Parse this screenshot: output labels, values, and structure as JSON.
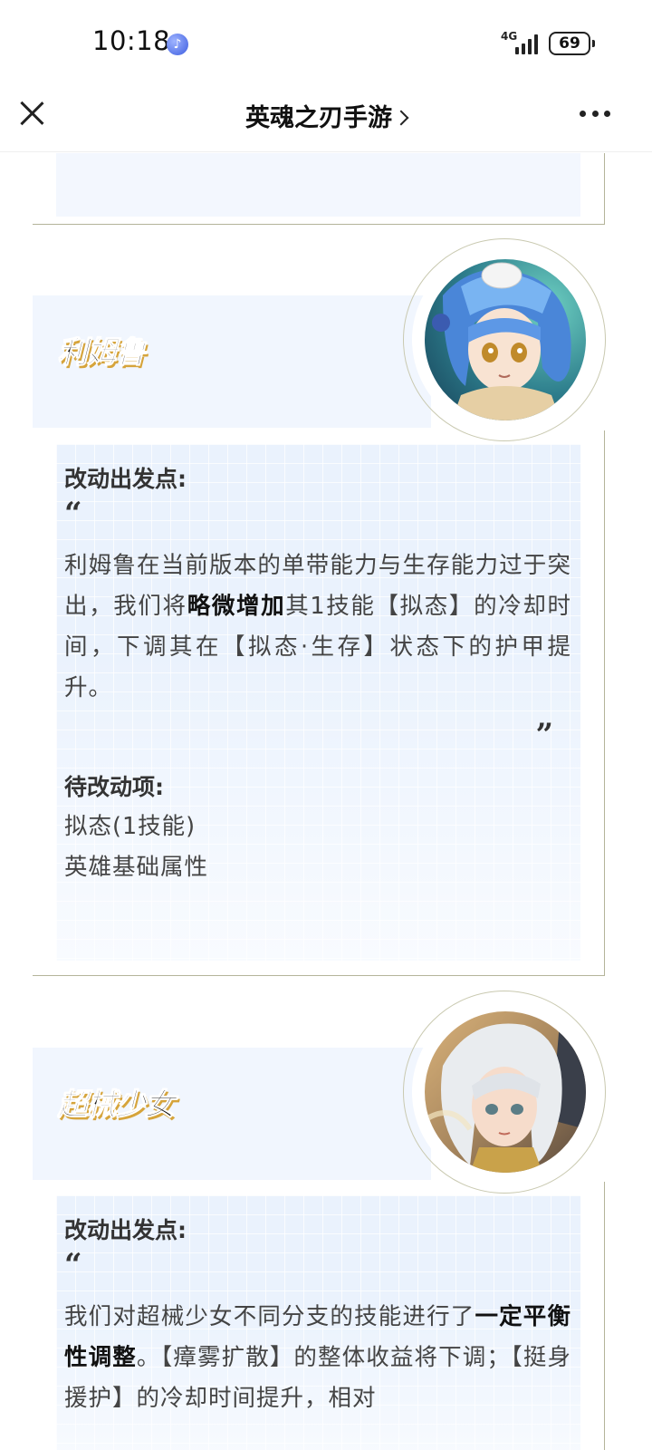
{
  "status": {
    "time": "10:18",
    "network": "4G",
    "battery": "69"
  },
  "nav": {
    "title": "英魂之刃手游"
  },
  "heroes": [
    {
      "name": "利姆鲁",
      "section_label": "改动出发点:",
      "quote_open": "“",
      "quote_close": "”",
      "text_1": "利姆鲁在当前版本的单带能力与生存能力过于突出，我们将",
      "text_bold": "略微增加",
      "text_2": "其1技能【拟态】的冷却时间，下调其在【拟态·生存】状态下的护甲提升。",
      "pending_label": "待改动项:",
      "pending_items": [
        "拟态(1技能)",
        "英雄基础属性"
      ]
    },
    {
      "name": "超械少女",
      "section_label": "改动出发点:",
      "quote_open": "“",
      "text_1": "我们对超械少女不同分支的技能进行了",
      "text_bold": "一定平衡性调整",
      "text_2": "。【瘴雾扩散】的整体收益将下调；【挺身援护】的冷却时间提升，相对"
    }
  ],
  "colors": {
    "panel": "#eaf2fd",
    "banner": "#f1f6fe",
    "line": "#b4b49a",
    "name_shadow": "#d6a43b"
  }
}
